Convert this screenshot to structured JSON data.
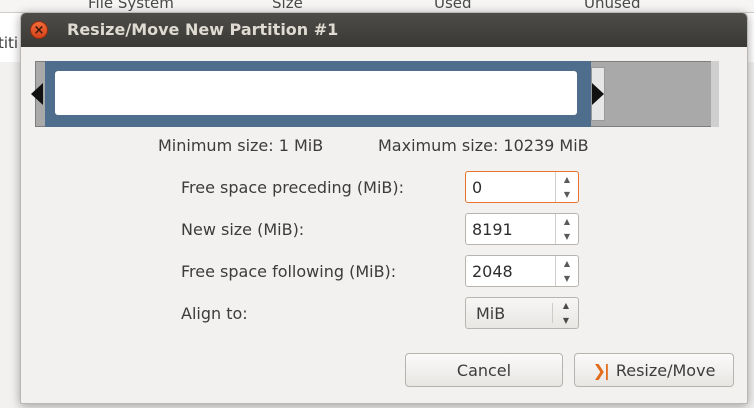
{
  "background": {
    "columns": [
      "File System",
      "Size",
      "Used",
      "Unused"
    ],
    "row_fragment": "titi"
  },
  "dialog": {
    "title": "Resize/Move New Partition #1",
    "close_glyph": "×"
  },
  "partition_graphic": {
    "used_fraction": 0.8,
    "colors": {
      "partition": "#4f6d8c",
      "unallocated": "#a9a9a9"
    }
  },
  "size_info": {
    "minimum": "Minimum size: 1 MiB",
    "maximum": "Maximum size: 10239 MiB"
  },
  "fields": {
    "free_preceding": {
      "label": "Free space preceding (MiB):",
      "value": "0"
    },
    "new_size": {
      "label": "New size (MiB):",
      "value": "8191"
    },
    "free_following": {
      "label": "Free space following (MiB):",
      "value": "2048"
    },
    "align_to": {
      "label": "Align to:",
      "value": "MiB"
    }
  },
  "spinner_glyphs": {
    "up": "▲",
    "down": "▼"
  },
  "buttons": {
    "cancel": "Cancel",
    "resize_move": "Resize/Move",
    "resize_icon_glyph": "❯|"
  }
}
